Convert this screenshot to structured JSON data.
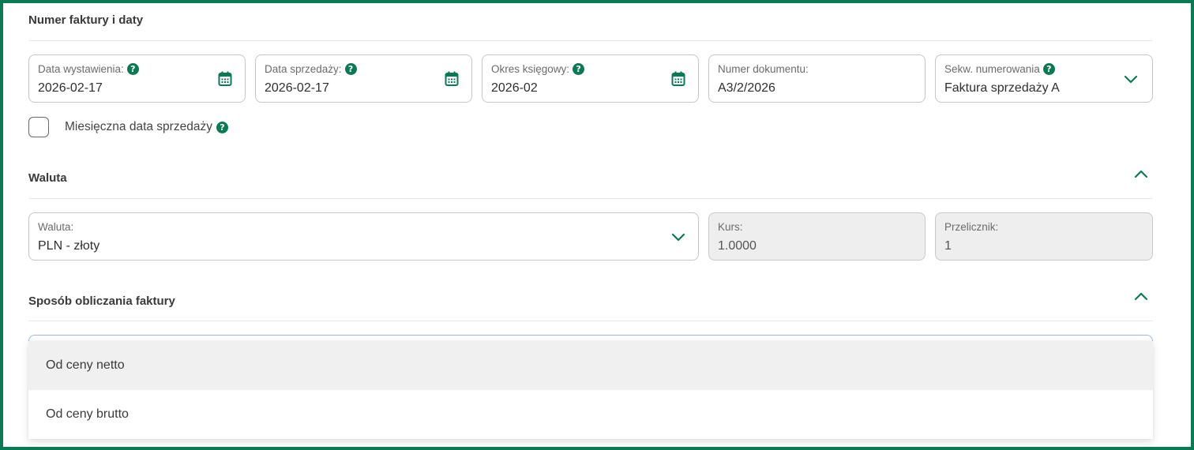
{
  "sections": {
    "numbers_dates": {
      "title": "Numer faktury i daty"
    },
    "currency": {
      "title": "Waluta"
    },
    "calc_method": {
      "title": "Sposób obliczania faktury"
    }
  },
  "fields": {
    "issue_date": {
      "label": "Data wystawienia:",
      "value": "2026-02-17"
    },
    "sale_date": {
      "label": "Data sprzedaży:",
      "value": "2026-02-17"
    },
    "accounting_period": {
      "label": "Okres księgowy:",
      "value": "2026-02"
    },
    "document_number": {
      "label": "Numer dokumentu:",
      "value": "A3/2/2026"
    },
    "numbering_sequence": {
      "label": "Sekw. numerowania",
      "value": "Faktura sprzedaży A"
    },
    "currency": {
      "label": "Waluta:",
      "value": "PLN - złoty"
    },
    "rate": {
      "label": "Kurs:",
      "value": "1.0000"
    },
    "converter": {
      "label": "Przelicznik:",
      "value": "1"
    }
  },
  "monthly_sale_date": {
    "label": "Miesięczna data sprzedaży",
    "checked": false
  },
  "help_glyph": "?",
  "dropdown": {
    "options": [
      "Od ceny netto",
      "Od ceny brutto"
    ],
    "hovered_index": 0
  },
  "colors": {
    "accent": "#0a7a55",
    "frame": "#0a7a55",
    "readonly_bg": "#eeeeee",
    "dropdown_focus_border": "#9bb8e0"
  },
  "icons": {
    "date_picker": "calendar-icon",
    "select": "chevron-down-icon",
    "collapse": "chevron-up-icon",
    "help": "help-icon"
  }
}
